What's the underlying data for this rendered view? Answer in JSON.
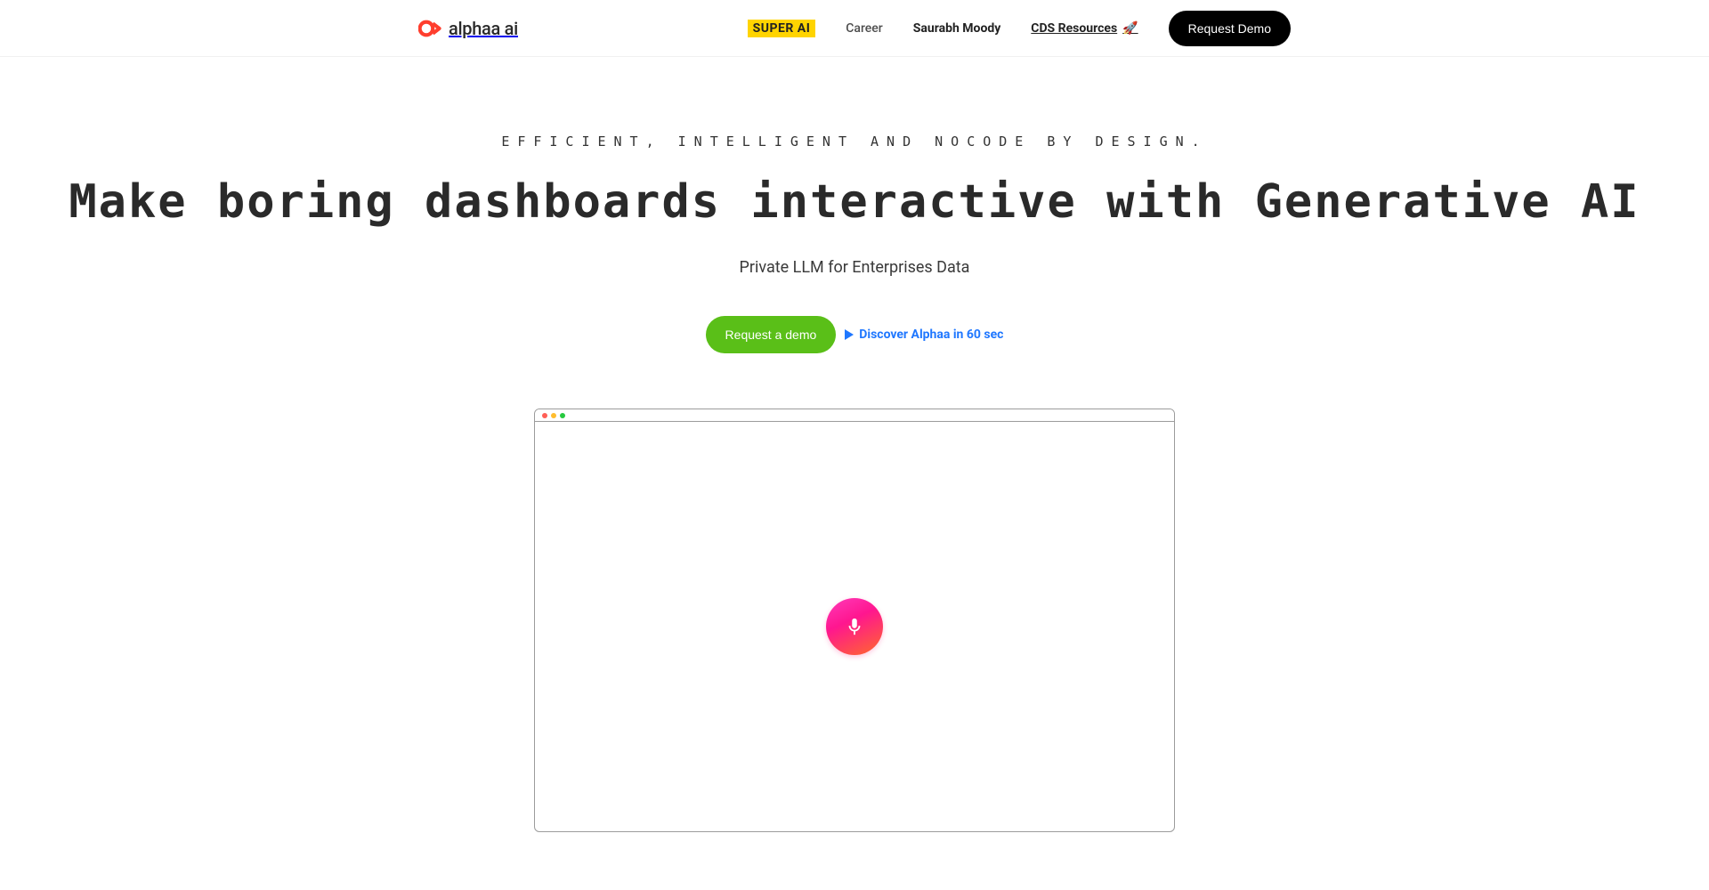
{
  "logo": {
    "text": "alphaa ai"
  },
  "nav": {
    "super": "SUPER AI",
    "career": "Career",
    "author": "Saurabh Moody",
    "cds": "CDS Resources",
    "rocket": "🚀",
    "cta": "Request Demo"
  },
  "hero": {
    "eyebrow": "EFFICIENT, INTELLIGENT AND NOCODE BY DESIGN.",
    "headline": "Make boring dashboards interactive with Generative AI",
    "subhead": "Private LLM for Enterprises Data",
    "primary_cta": "Request a demo",
    "secondary_cta": "Discover Alphaa in 60 sec"
  }
}
